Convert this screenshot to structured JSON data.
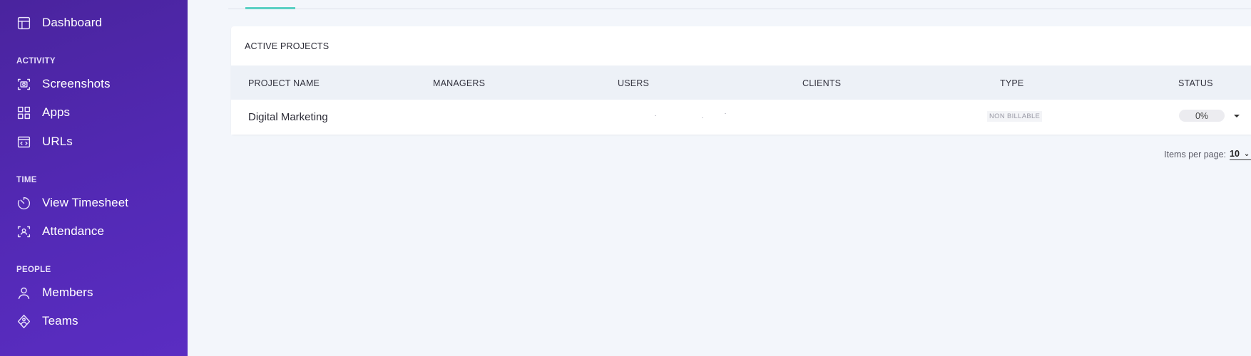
{
  "sidebar": {
    "items": {
      "dashboard": {
        "label": "Dashboard",
        "icon": "dashboard-icon"
      },
      "screenshots": {
        "label": "Screenshots",
        "icon": "camera-icon"
      },
      "apps": {
        "label": "Apps",
        "icon": "apps-grid-icon"
      },
      "urls": {
        "label": "URLs",
        "icon": "browser-code-icon"
      },
      "timesheet": {
        "label": "View Timesheet",
        "icon": "timer-icon"
      },
      "attendance": {
        "label": "Attendance",
        "icon": "attendance-icon"
      },
      "members": {
        "label": "Members",
        "icon": "user-icon"
      },
      "teams": {
        "label": "Teams",
        "icon": "teams-icon"
      }
    },
    "sections": {
      "activity": "ACTIVITY",
      "time": "TIME",
      "people": "PEOPLE"
    },
    "colors": {
      "gradient_start": "#4a249e",
      "gradient_end": "#5a2dc2"
    }
  },
  "main": {
    "tab_accent_color": "#5ad0c3",
    "card": {
      "title": "ACTIVE PROJECTS",
      "columns": [
        "PROJECT NAME",
        "MANAGERS",
        "USERS",
        "CLIENTS",
        "TYPE",
        "STATUS"
      ],
      "rows": [
        {
          "project_name": "Digital Marketing",
          "managers": "",
          "users": "",
          "clients": "",
          "type": "NON BILLABLE",
          "status": "0%"
        }
      ]
    },
    "pagination": {
      "items_per_page_label": "Items per page:",
      "items_per_page_value": "10"
    }
  }
}
